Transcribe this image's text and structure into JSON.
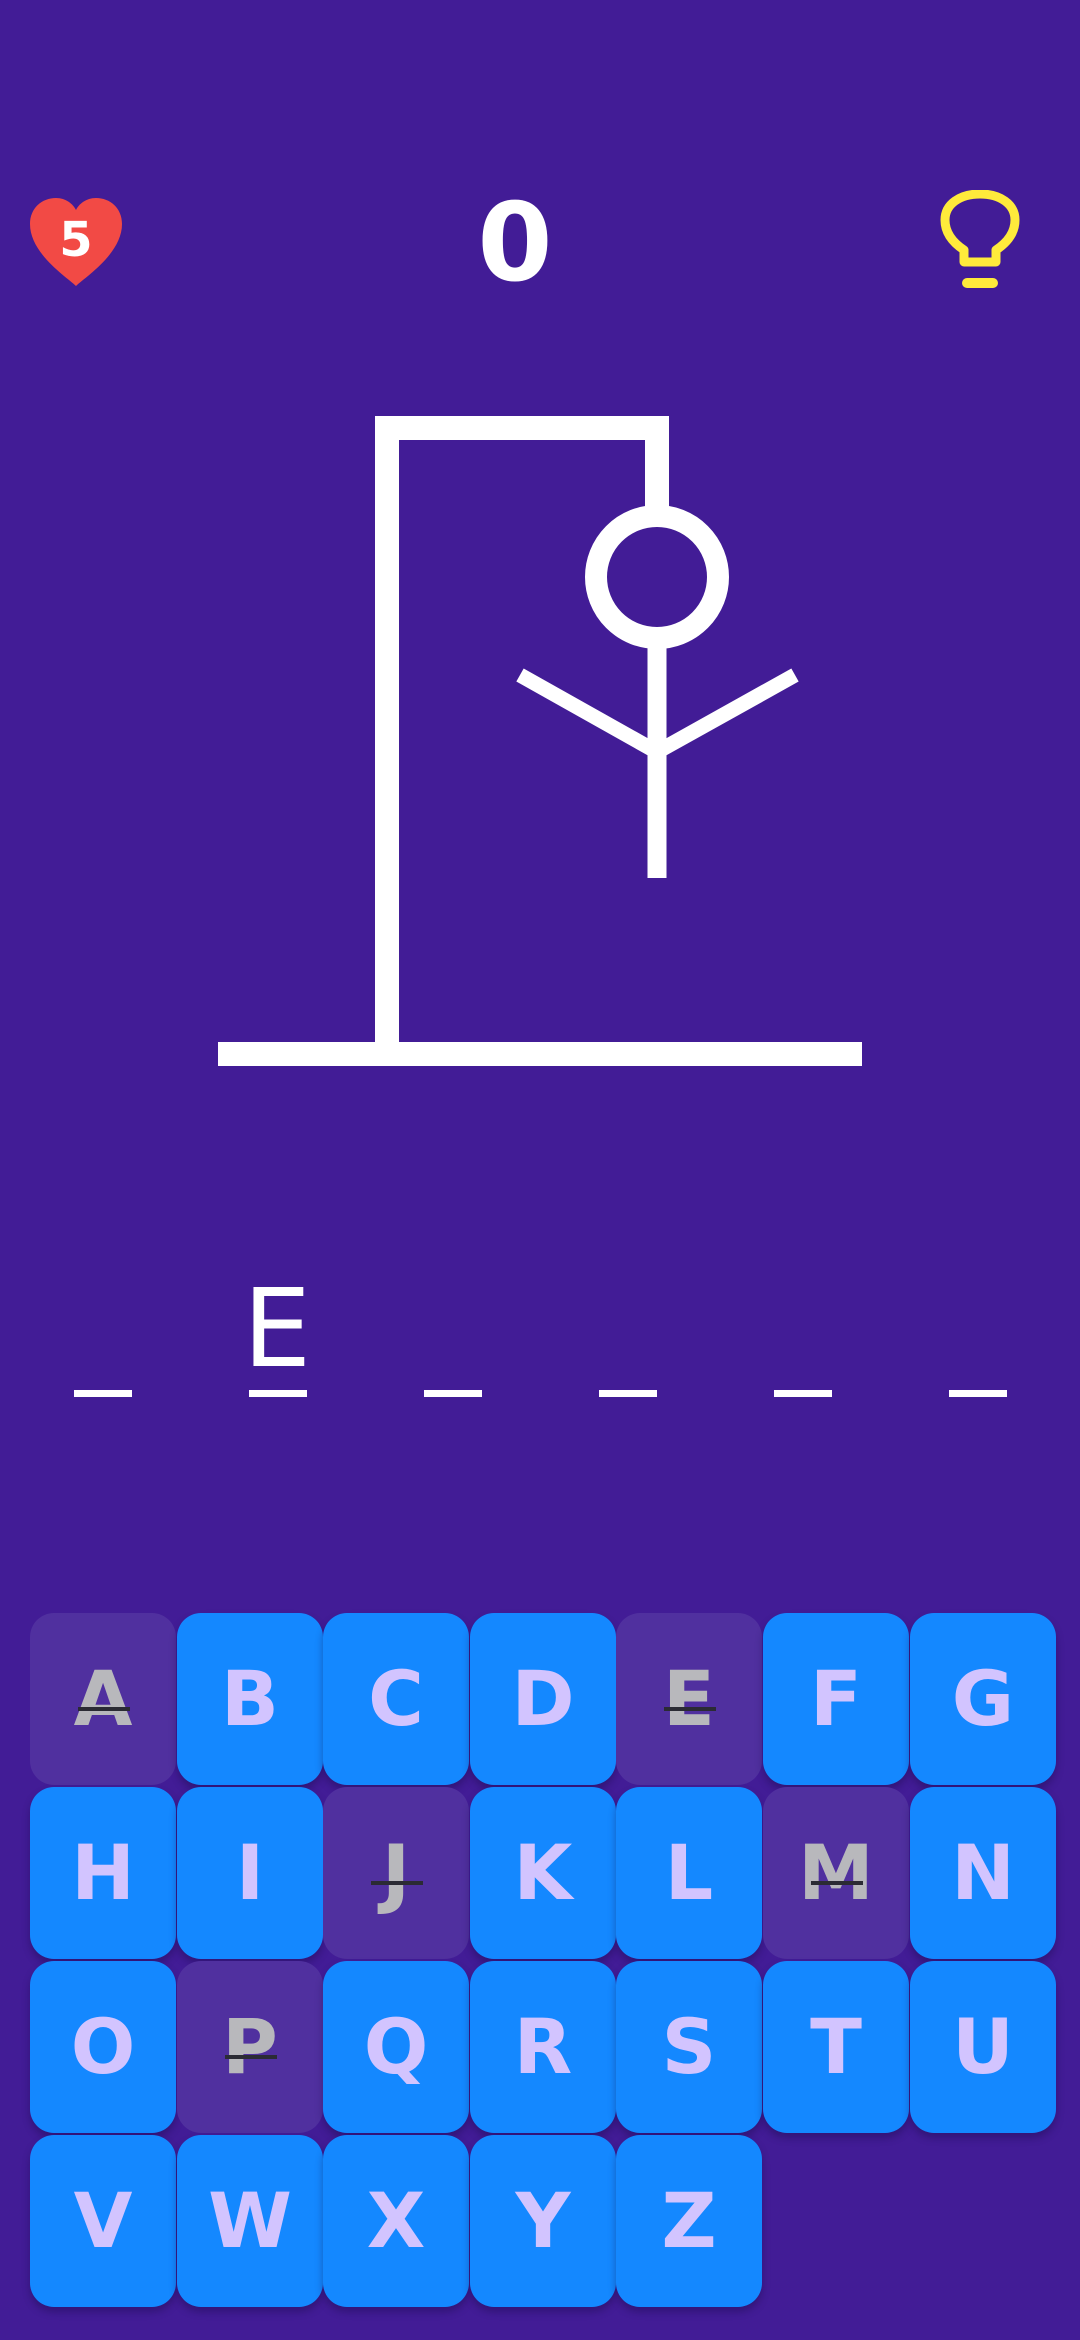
{
  "hud": {
    "lives": "5",
    "score": "0",
    "heart_icon": "heart-icon",
    "hint_icon": "lightbulb-icon",
    "heart_color": "#f24a45",
    "hint_color": "#ffeb3b"
  },
  "hangman": {
    "parts_shown": [
      "gallows",
      "rope",
      "head",
      "body",
      "left-arm",
      "right-arm"
    ],
    "stroke_color": "#ffffff"
  },
  "word": {
    "slots": [
      "",
      "E",
      "",
      "",
      "",
      ""
    ]
  },
  "keyboard": {
    "keys": [
      {
        "letter": "A",
        "used": true
      },
      {
        "letter": "B",
        "used": false
      },
      {
        "letter": "C",
        "used": false
      },
      {
        "letter": "D",
        "used": false
      },
      {
        "letter": "E",
        "used": true
      },
      {
        "letter": "F",
        "used": false
      },
      {
        "letter": "G",
        "used": false
      },
      {
        "letter": "H",
        "used": false
      },
      {
        "letter": "I",
        "used": false
      },
      {
        "letter": "J",
        "used": true
      },
      {
        "letter": "K",
        "used": false
      },
      {
        "letter": "L",
        "used": false
      },
      {
        "letter": "M",
        "used": true
      },
      {
        "letter": "N",
        "used": false
      },
      {
        "letter": "O",
        "used": false
      },
      {
        "letter": "P",
        "used": true
      },
      {
        "letter": "Q",
        "used": false
      },
      {
        "letter": "R",
        "used": false
      },
      {
        "letter": "S",
        "used": false
      },
      {
        "letter": "T",
        "used": false
      },
      {
        "letter": "U",
        "used": false
      },
      {
        "letter": "V",
        "used": false
      },
      {
        "letter": "W",
        "used": false
      },
      {
        "letter": "X",
        "used": false
      },
      {
        "letter": "Y",
        "used": false
      },
      {
        "letter": "Z",
        "used": false
      }
    ],
    "key_color": "#1488ff",
    "used_key_color": "#50309f",
    "letter_color": "#d2c4ff"
  },
  "colors": {
    "background": "#421c96"
  }
}
